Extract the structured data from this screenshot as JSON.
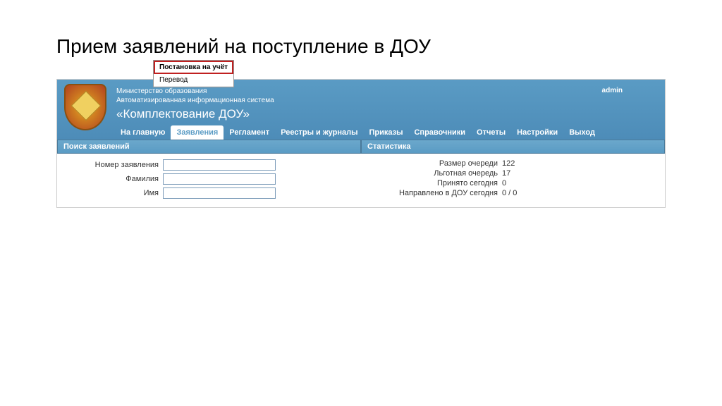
{
  "slide": {
    "title": "Прием заявлений на поступление в ДОУ"
  },
  "header": {
    "line1": "Министерство образования",
    "line2": "Автоматизированная информационная система",
    "system": "«Комплектование ДОУ»",
    "admin": "admin"
  },
  "nav": {
    "items": [
      "На главную",
      "Заявления",
      "Регламент",
      "Реестры и журналы",
      "Приказы",
      "Справочники",
      "Отчеты",
      "Настройки",
      "Выход"
    ],
    "activeIndex": 1
  },
  "dropdown": {
    "items": [
      "Постановка на учёт",
      "Перевод"
    ],
    "highlightedIndex": 0
  },
  "searchPanel": {
    "title": "Поиск заявлений",
    "fields": {
      "number": {
        "label": "Номер заявления",
        "value": ""
      },
      "lastname": {
        "label": "Фамилия",
        "value": ""
      },
      "firstname": {
        "label": "Имя",
        "value": ""
      }
    }
  },
  "statsPanel": {
    "title": "Статистика",
    "rows": [
      {
        "label": "Размер очереди",
        "value": "122"
      },
      {
        "label": "Льготная очередь",
        "value": "17"
      },
      {
        "label": "Принято сегодня",
        "value": "0"
      },
      {
        "label": "Направлено в ДОУ сегодня",
        "value": "0 / 0"
      }
    ]
  }
}
